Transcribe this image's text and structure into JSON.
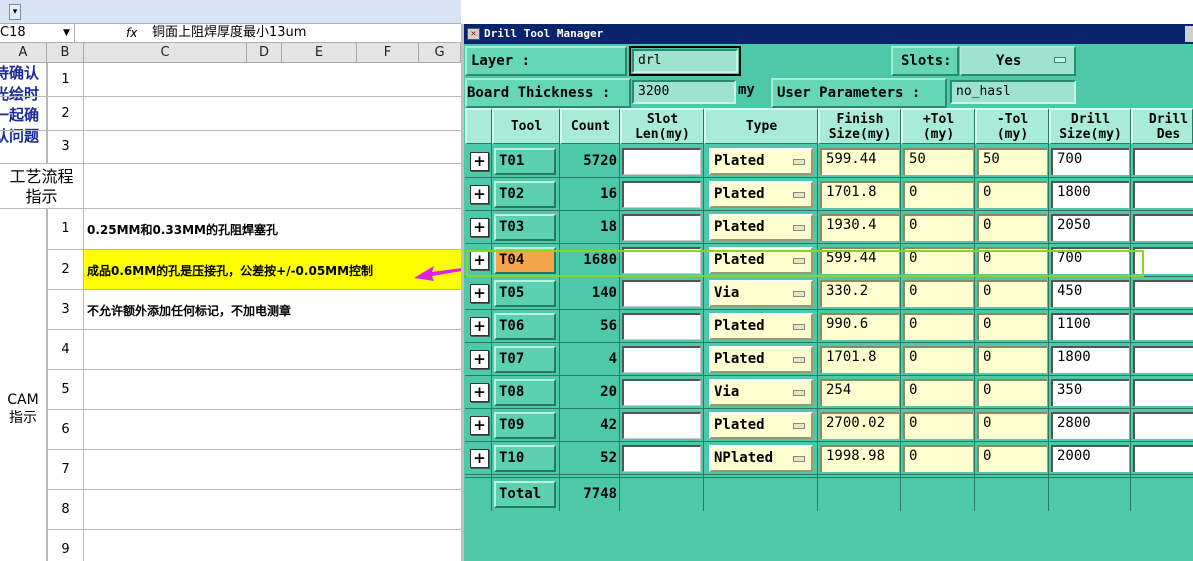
{
  "excel": {
    "cell_ref": "C18",
    "fx_label": "fx",
    "formula_text": "铜面上阻焊厚度最小13um",
    "columns": [
      "A",
      "B",
      "C",
      "D",
      "E",
      "F",
      "G"
    ],
    "top_left_lines": [
      "待确认",
      "光绘时",
      "一起确",
      "认问题"
    ],
    "process_label": [
      "工艺流程",
      "指示"
    ],
    "cam_label": [
      "CAM",
      "指示"
    ],
    "rows": [
      {
        "num": "1",
        "text": ""
      },
      {
        "num": "2",
        "text": ""
      },
      {
        "num": "3",
        "text": ""
      },
      {
        "num": "1",
        "text": "0.25MM和0.33MM的孔阻焊塞孔"
      },
      {
        "num": "2",
        "text": "成品0.6MM的孔是压接孔，公差按+/-0.05MM控制"
      },
      {
        "num": "3",
        "text": "不允许额外添加任何标记，不加电测章"
      },
      {
        "num": "4",
        "text": ""
      },
      {
        "num": "5",
        "text": ""
      },
      {
        "num": "6",
        "text": ""
      },
      {
        "num": "7",
        "text": ""
      },
      {
        "num": "8",
        "text": ""
      },
      {
        "num": "9",
        "text": ""
      }
    ],
    "highlight_color": "#ffff00"
  },
  "dtm": {
    "title": "Drill Tool Manager",
    "layer_label": "Layer        :",
    "layer_value": "drl",
    "slots_label": "Slots:",
    "slots_value": "Yes",
    "thickness_label": "Board Thickness :",
    "thickness_value": "3200",
    "thickness_unit": "my",
    "user_params_label": "User Parameters :",
    "user_params_value": "no_hasl",
    "headers": {
      "tool": "Tool",
      "count": "Count",
      "slot_len": [
        "Slot",
        "Len(my)"
      ],
      "type": "Type",
      "finish": [
        "Finish",
        "Size(my)"
      ],
      "ptol": [
        "+Tol",
        "(my)"
      ],
      "ntol": [
        "-Tol",
        "(my)"
      ],
      "drill": [
        "Drill",
        "Size(my)"
      ],
      "drill_des": [
        "Drill",
        "Des"
      ]
    },
    "rows": [
      {
        "tool": "T01",
        "count": "5720",
        "type": "Plated",
        "finish": "599.44",
        "ptol": "50",
        "ntol": "50",
        "drill": "700",
        "exp": "+"
      },
      {
        "tool": "T02",
        "count": "16",
        "type": "Plated",
        "finish": "1701.8",
        "ptol": "0",
        "ntol": "0",
        "drill": "1800",
        "exp": "+"
      },
      {
        "tool": "T03",
        "count": "18",
        "type": "Plated",
        "finish": "1930.4",
        "ptol": "0",
        "ntol": "0",
        "drill": "2050",
        "exp": "+"
      },
      {
        "tool": "T04",
        "count": "1680",
        "type": "Plated",
        "finish": "599.44",
        "ptol": "0",
        "ntol": "0",
        "drill": "700",
        "exp": "+"
      },
      {
        "tool": "T05",
        "count": "140",
        "type": "Via",
        "finish": "330.2",
        "ptol": "0",
        "ntol": "0",
        "drill": "450",
        "exp": "+"
      },
      {
        "tool": "T06",
        "count": "56",
        "type": "Plated",
        "finish": "990.6",
        "ptol": "0",
        "ntol": "0",
        "drill": "1100",
        "exp": "+"
      },
      {
        "tool": "T07",
        "count": "4",
        "type": "Plated",
        "finish": "1701.8",
        "ptol": "0",
        "ntol": "0",
        "drill": "1800",
        "exp": "+"
      },
      {
        "tool": "T08",
        "count": "20",
        "type": "Via",
        "finish": "254",
        "ptol": "0",
        "ntol": "0",
        "drill": "350",
        "exp": "+"
      },
      {
        "tool": "T09",
        "count": "42",
        "type": "Plated",
        "finish": "2700.02",
        "ptol": "0",
        "ntol": "0",
        "drill": "2800",
        "exp": "+"
      },
      {
        "tool": "T10",
        "count": "52",
        "type": "NPlated",
        "finish": "1998.98",
        "ptol": "0",
        "ntol": "0",
        "drill": "2000",
        "exp": "+"
      }
    ],
    "total_label": "Total",
    "total_value": "7748",
    "selected_tool": "T04",
    "accent_bg": "#4dc9aa",
    "selected_color": "#f5a54a"
  }
}
